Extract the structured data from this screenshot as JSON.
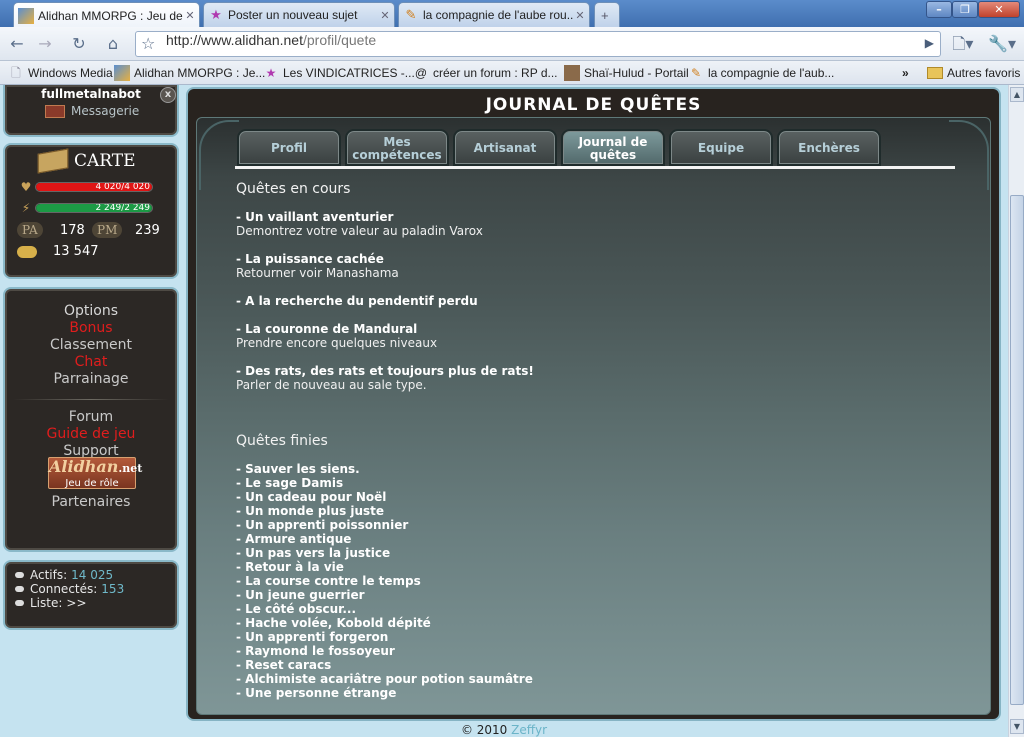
{
  "browser": {
    "tabs": [
      {
        "title": "Alidhan MMORPG : Jeu de r...",
        "icon": "alidhan-icon",
        "active": true
      },
      {
        "title": "Poster un nouveau sujet",
        "icon": "star-icon",
        "active": false
      },
      {
        "title": "la compagnie de l'aube rou...",
        "icon": "forum-icon",
        "active": false
      }
    ],
    "url_host": "http://www.alidhan.net",
    "url_path": "/profil/quete",
    "bookmarks": [
      {
        "label": "Windows Media",
        "icon": "page-icon"
      },
      {
        "label": "Alidhan MMORPG : Je...",
        "icon": "alidhan-icon"
      },
      {
        "label": "Les VINDICATRICES -...",
        "icon": "star-icon"
      },
      {
        "label": "créer un forum : RP d...",
        "icon": "spiral-icon"
      },
      {
        "label": "Shaï-Hulud - Portail",
        "icon": "avatar-icon"
      },
      {
        "label": "la compagnie de l'aub...",
        "icon": "forum-icon"
      }
    ],
    "bookmarks_more": "»",
    "other_bookmarks": "Autres favoris"
  },
  "sidebar": {
    "username": "fullmetalnabot",
    "messagerie": "Messagerie",
    "close": "x",
    "map_label": "CARTE",
    "hp": {
      "text": "4 020/4 020",
      "fraction": 1.0,
      "color": "#e01515"
    },
    "mana": {
      "text": "2 249/2 249",
      "fraction": 1.0,
      "color": "#1c9a45"
    },
    "pa_label": "PA",
    "pa_value": "178",
    "pm_label": "PM",
    "pm_value": "239",
    "gold": "13 547",
    "links": [
      {
        "label": "Options",
        "style": "normal"
      },
      {
        "label": "Bonus",
        "style": "red"
      },
      {
        "label": "Classement",
        "style": "normal"
      },
      {
        "label": "Chat",
        "style": "red"
      },
      {
        "label": "Parrainage",
        "style": "normal"
      },
      {
        "label": "Forum",
        "style": "normal"
      },
      {
        "label": "Guide de jeu",
        "style": "red"
      },
      {
        "label": "Support",
        "style": "normal"
      },
      {
        "label": "Partenaires",
        "style": "normal"
      }
    ],
    "logo_title": "Alidhan",
    "logo_suffix": ".net",
    "logo_sub": "Jeu de rôle",
    "stats": [
      {
        "label": "Actifs:",
        "value": "14 025"
      },
      {
        "label": "Connectés:",
        "value": "153"
      },
      {
        "label": "Liste:",
        "value": ">>"
      }
    ]
  },
  "main": {
    "title": "JOURNAL DE QUÊTES",
    "tabs": [
      {
        "label": "Profil",
        "active": false
      },
      {
        "label": "Mes compétences",
        "active": false
      },
      {
        "label": "Artisanat",
        "active": false
      },
      {
        "label": "Journal de quêtes",
        "active": true
      },
      {
        "label": "Equipe",
        "active": false
      },
      {
        "label": "Enchères",
        "active": false
      }
    ],
    "current_heading": "Quêtes en cours",
    "current": [
      {
        "title": "- Un vaillant aventurier",
        "desc": "Demontrez votre valeur au paladin Varox"
      },
      {
        "title": "- La puissance cachée",
        "desc": "Retourner voir Manashama"
      },
      {
        "title": "- A la recherche du pendentif perdu",
        "desc": ""
      },
      {
        "title": "- La couronne de Mandural",
        "desc": "Prendre encore quelques niveaux"
      },
      {
        "title": "- Des rats, des rats et toujours plus de rats!",
        "desc": "Parler de nouveau au sale type."
      }
    ],
    "finished_heading": "Quêtes finies",
    "finished": [
      "- Sauver les siens.",
      "- Le sage Damis",
      "- Un cadeau pour Noël",
      "- Un monde plus juste",
      "- Un apprenti poissonnier",
      "- Armure antique",
      "- Un pas vers la justice",
      "- Retour à la vie",
      "- La course contre le temps",
      "- Un jeune guerrier",
      "- Le côté obscur...",
      "- Hache volée, Kobold dépité",
      "- Un apprenti forgeron",
      "- Raymond le fossoyeur",
      "- Reset caracs",
      "- Alchimiste acariâtre pour potion saumâtre",
      "- Une personne étrange"
    ]
  },
  "footer": {
    "copyright": "© 2010",
    "author": "Zeffyr"
  }
}
